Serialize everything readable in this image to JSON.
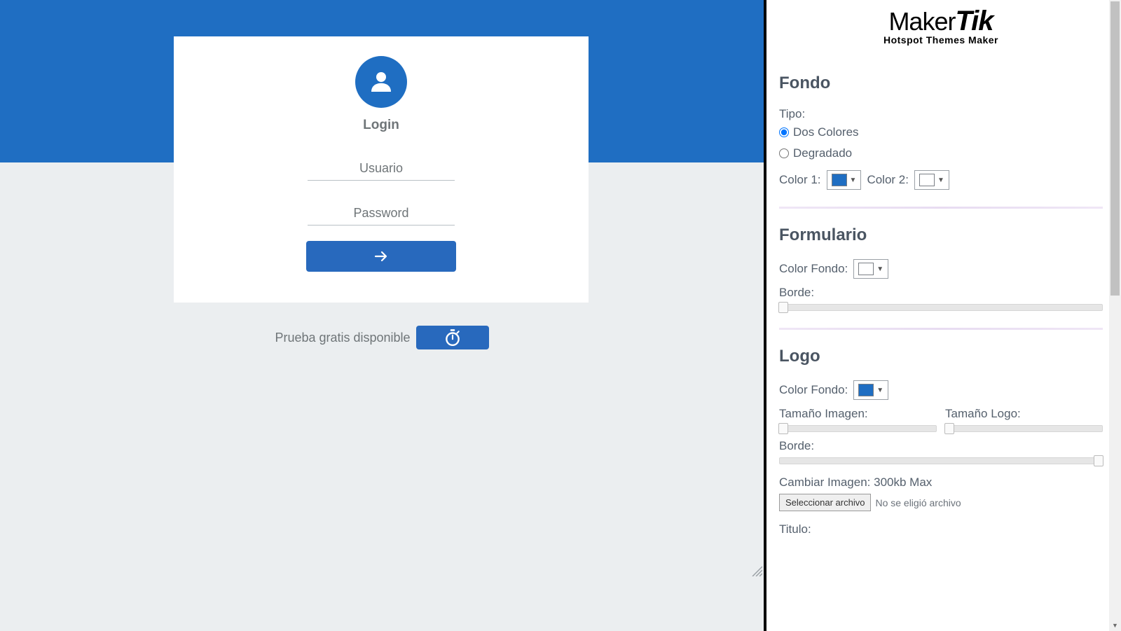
{
  "preview": {
    "login_title": "Login",
    "username_placeholder": "Usuario",
    "password_placeholder": "Password",
    "trial_text": "Prueba gratis disponible",
    "accent_color": "#2869bd",
    "top_bg_color": "#1f6ec2",
    "card_bg": "#ffffff"
  },
  "brand": {
    "name_part1": "Maker",
    "name_part2": "Tik",
    "tagline": "Hotspot Themes Maker"
  },
  "sections": {
    "fondo": {
      "title": "Fondo",
      "tipo_label": "Tipo:",
      "option_two_colors": "Dos Colores",
      "option_gradient": "Degradado",
      "selected_option": "dos_colores",
      "color1_label": "Color 1:",
      "color1_value": "#1f6ec2",
      "color2_label": "Color 2:",
      "color2_value": "#ffffff"
    },
    "formulario": {
      "title": "Formulario",
      "bg_label": "Color Fondo:",
      "bg_value": "#ffffff",
      "border_label": "Borde:",
      "border_value": 0
    },
    "logo": {
      "title": "Logo",
      "bg_label": "Color Fondo:",
      "bg_value": "#1f6ec2",
      "img_size_label": "Tamaño Imagen:",
      "logo_size_label": "Tamaño Logo:",
      "border_label": "Borde:",
      "border_value": 100,
      "change_img_label": "Cambiar Imagen: 300kb Max",
      "file_btn": "Seleccionar archivo",
      "file_status": "No se eligió archivo",
      "title_label": "Titulo:"
    }
  }
}
